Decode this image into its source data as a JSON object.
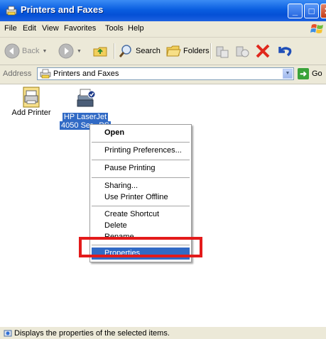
{
  "window": {
    "title": "Printers and Faxes"
  },
  "menubar": {
    "items": [
      "File",
      "Edit",
      "View",
      "Favorites",
      "Tools",
      "Help"
    ]
  },
  "toolbar": {
    "back_label": "Back",
    "search_label": "Search",
    "folders_label": "Folders"
  },
  "address": {
    "label": "Address",
    "value": "Printers and Faxes",
    "go_label": "Go"
  },
  "items": [
    {
      "label": "Add Printer",
      "icon": "add-printer-icon"
    },
    {
      "label_line1": "HP LaserJet",
      "label_line2": "4050 Ser...PS",
      "icon": "printer-icon",
      "selected": true
    }
  ],
  "context_menu": {
    "items": [
      "Open",
      "Printing Preferences...",
      "Pause Printing",
      "Sharing...",
      "Use Printer Offline",
      "Create Shortcut",
      "Delete",
      "Rename",
      "Properties"
    ],
    "highlighted": "Properties"
  },
  "status": {
    "text": "Displays the properties of the selected items."
  },
  "colors": {
    "title_bar": "#0a5ee0",
    "selection": "#316ac5",
    "annotation": "#e31b1b",
    "chrome": "#ece9d8"
  }
}
